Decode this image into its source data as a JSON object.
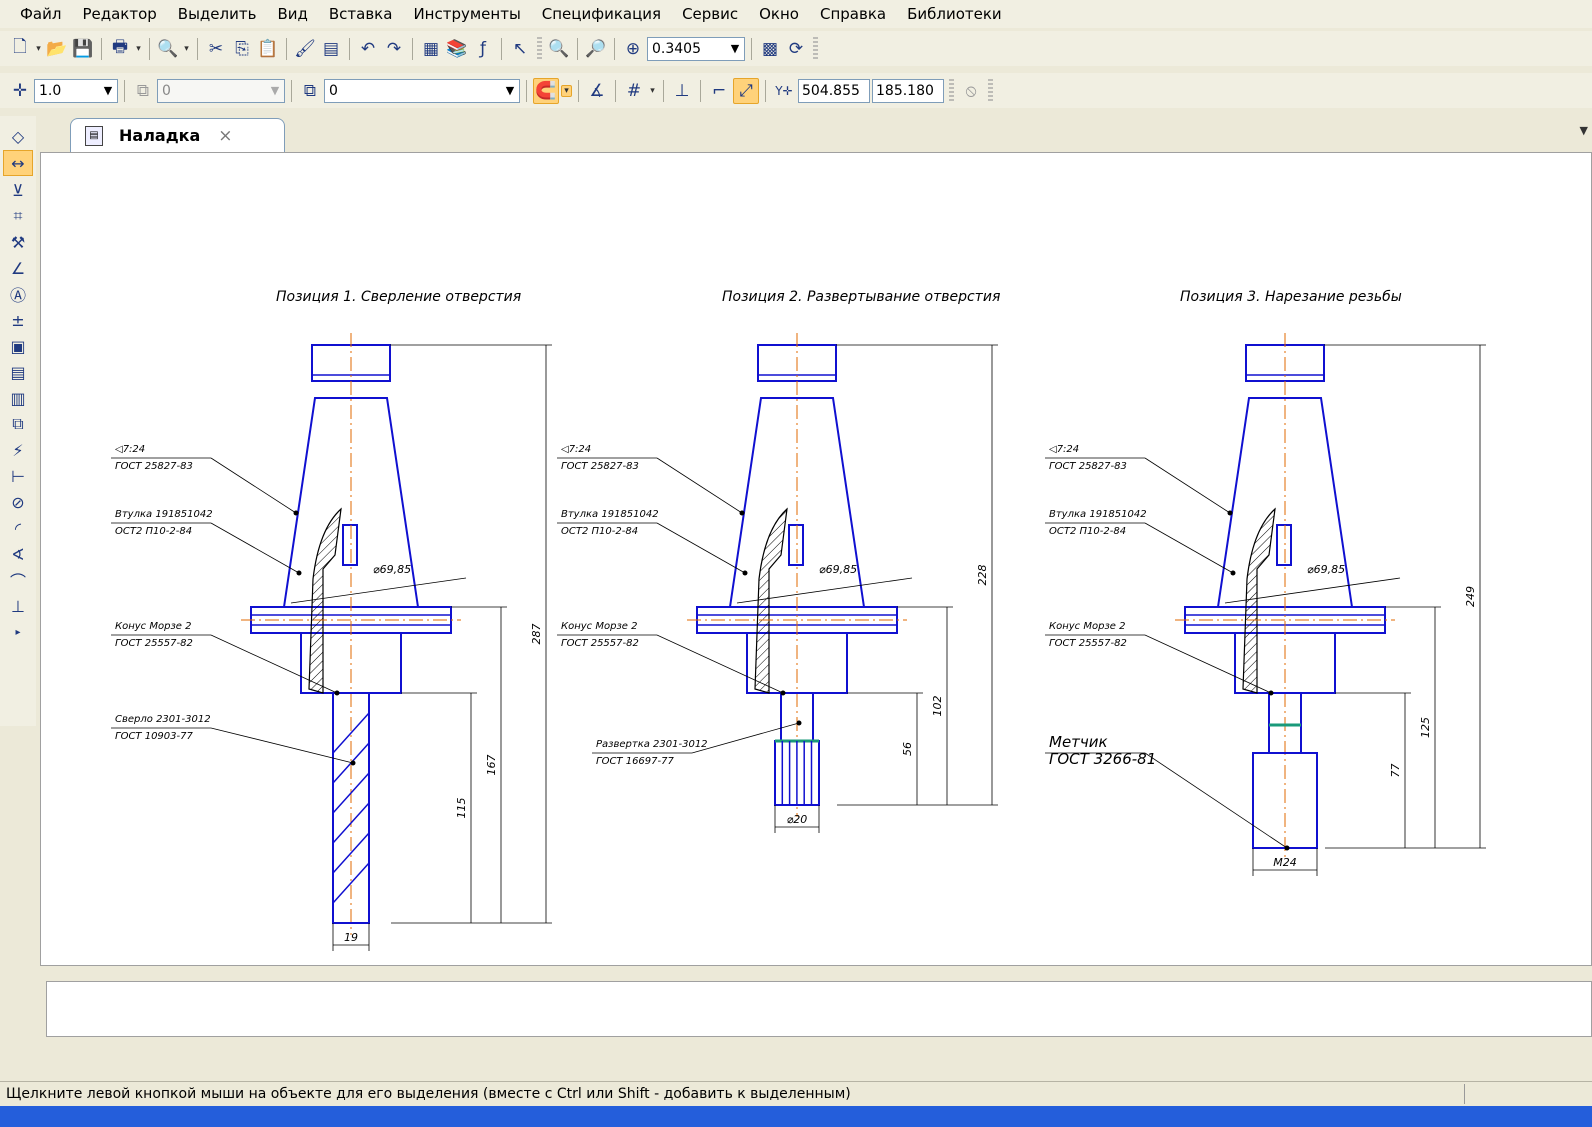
{
  "menu": [
    "Файл",
    "Редактор",
    "Выделить",
    "Вид",
    "Вставка",
    "Инструменты",
    "Спецификация",
    "Сервис",
    "Окно",
    "Справка",
    "Библиотеки"
  ],
  "toolbar2": {
    "step": "1.0",
    "layer_state": "0",
    "layer": "0",
    "coord_x": "504.855",
    "coord_y": "185.180"
  },
  "toolbar1": {
    "zoom": "0.3405"
  },
  "document_tab": {
    "title": "Наладка",
    "close": "×"
  },
  "status": "Щелкните левой кнопкой мыши на объекте для его выделения (вместе с Ctrl или Shift - добавить к выделенным)",
  "drawing": {
    "positions": [
      {
        "title": "Позиция 1. Сверление отверстия",
        "callouts": [
          {
            "line1": "◁7:24",
            "line2": "ГОСТ 25827-83"
          },
          {
            "line1": "Втулка 191851042",
            "line2": "ОСТ2 П10-2-84"
          },
          {
            "line1": "Конус Морзе 2",
            "line2": "ГОСТ 25557-82"
          },
          {
            "line1": "Сверло 2301-3012",
            "line2": "ГОСТ 10903-77"
          }
        ],
        "dims": {
          "diam_flange": "⌀69,85",
          "overall": "287",
          "shank": "167",
          "tool": "115",
          "diam_tool": "19"
        }
      },
      {
        "title": "Позиция 2. Развертывание отверстия",
        "callouts": [
          {
            "line1": "◁7:24",
            "line2": "ГОСТ 25827-83"
          },
          {
            "line1": "Втулка 191851042",
            "line2": "ОСТ2 П10-2-84"
          },
          {
            "line1": "Конус Морзе 2",
            "line2": "ГОСТ 25557-82"
          },
          {
            "line1": "Развертка 2301-3012",
            "line2": "ГОСТ 16697-77"
          }
        ],
        "dims": {
          "diam_flange": "⌀69,85",
          "overall": "228",
          "shank": "102",
          "tool": "56",
          "diam_tool": "⌀20"
        }
      },
      {
        "title": "Позиция 3. Нарезание резьбы",
        "callouts": [
          {
            "line1": "◁7:24",
            "line2": "ГОСТ 25827-83"
          },
          {
            "line1": "Втулка 191851042",
            "line2": "ОСТ2 П10-2-84"
          },
          {
            "line1": "Конус Морзе 2",
            "line2": "ГОСТ 25557-82"
          },
          {
            "line1": "Метчик",
            "line2": "ГОСТ 3266-81"
          }
        ],
        "dims": {
          "diam_flange": "⌀69,85",
          "overall": "249",
          "shank": "125",
          "tool": "77",
          "diam_tool": "M24"
        }
      }
    ]
  }
}
